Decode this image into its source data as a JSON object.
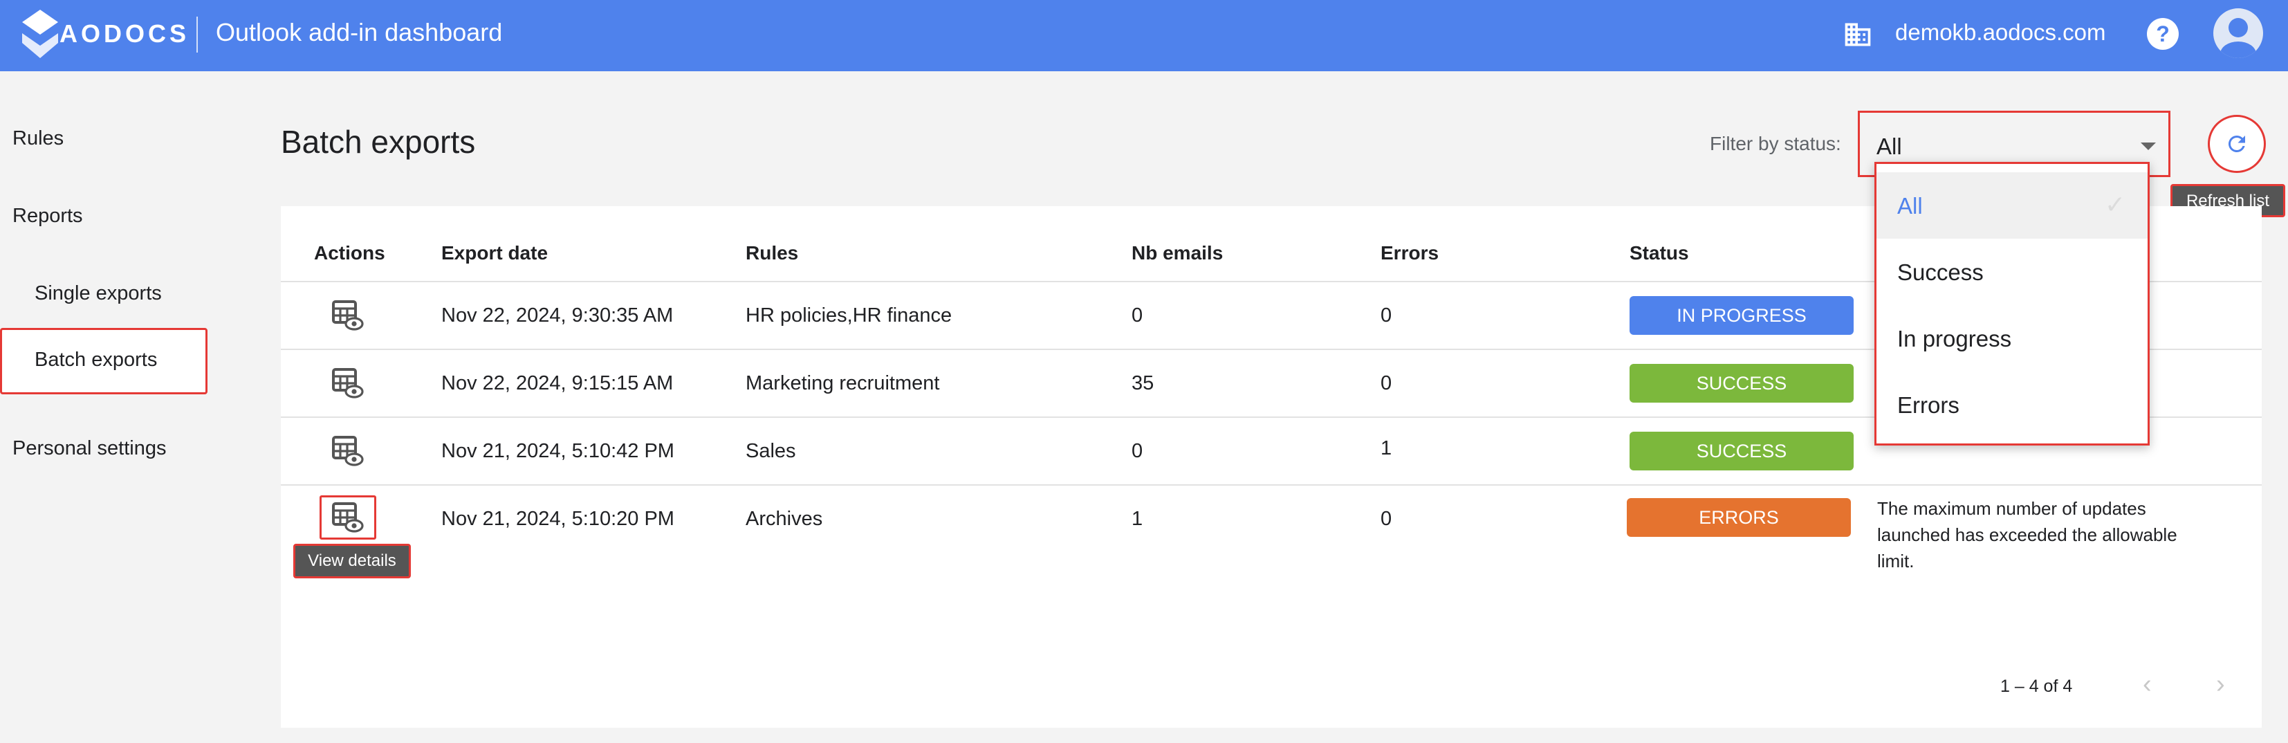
{
  "header": {
    "brand": "AODOCS",
    "app_title": "Outlook add-in dashboard",
    "domain": "demokb.aodocs.com",
    "help_symbol": "?",
    "colors": {
      "bar": "#4f82ec"
    }
  },
  "sidebar": {
    "items": [
      {
        "label": "Rules"
      },
      {
        "label": "Reports"
      },
      {
        "label": "Single exports"
      },
      {
        "label": "Batch exports",
        "active": true
      },
      {
        "label": "Personal settings"
      }
    ]
  },
  "main": {
    "title": "Batch exports",
    "filter": {
      "label": "Filter by status:",
      "value": "All",
      "options": [
        {
          "label": "All",
          "selected": true
        },
        {
          "label": "Success"
        },
        {
          "label": "In progress"
        },
        {
          "label": "Errors"
        }
      ]
    },
    "refresh_tooltip": "Refresh list",
    "table": {
      "columns": [
        "Actions",
        "Export date",
        "Rules",
        "Nb emails",
        "Errors",
        "Status"
      ],
      "rows": [
        {
          "date": "Nov 22, 2024, 9:30:35 AM",
          "rules": "HR policies,HR finance",
          "nb_emails": "0",
          "errors": "0",
          "status": "IN PROGRESS",
          "status_color": "#4f82ec",
          "message": ""
        },
        {
          "date": "Nov 22, 2024, 9:15:15 AM",
          "rules": "Marketing recruitment",
          "nb_emails": "35",
          "errors": "0",
          "status": "SUCCESS",
          "status_color": "#7cb83c",
          "message": ""
        },
        {
          "date": "Nov 21, 2024, 5:10:42 PM",
          "rules": "Sales",
          "nb_emails": "0",
          "errors": "1",
          "status": "SUCCESS",
          "status_color": "#7cb83c",
          "message": ""
        },
        {
          "date": "Nov 21, 2024, 5:10:20 PM",
          "rules": "Archives",
          "nb_emails": "1",
          "errors": "0",
          "status": "ERRORS",
          "status_color": "#e5732f",
          "message": "The maximum number of updates launched has exceeded the allowable limit."
        }
      ],
      "view_tooltip": "View details",
      "paginator": "1 – 4 of 4"
    }
  }
}
